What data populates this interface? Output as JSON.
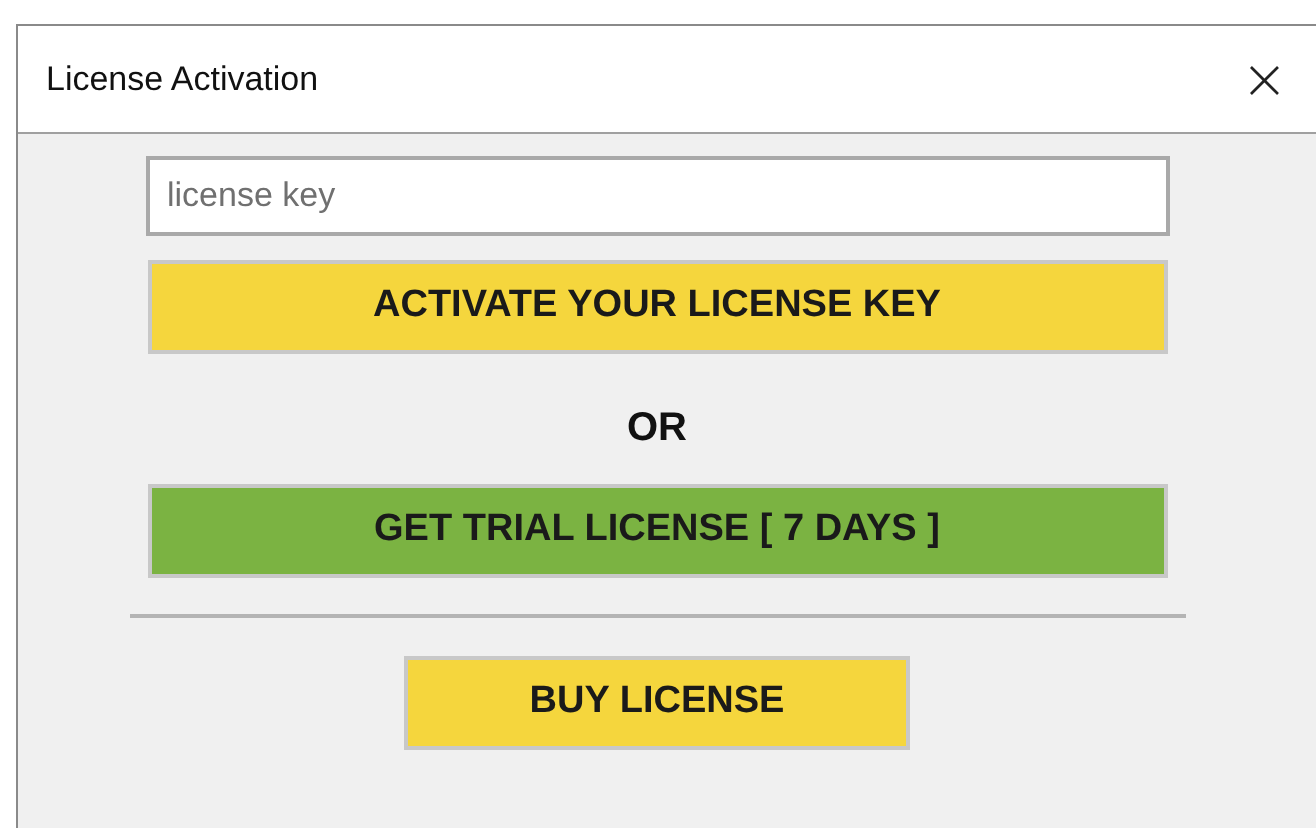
{
  "window": {
    "title": "License Activation",
    "close": "×"
  },
  "license_field": {
    "placeholder": "license key"
  },
  "buttons": [
    {
      "label": "ACTIVATE YOUR LICENSE KEY",
      "color": "#f5d63d"
    }
  ],
  "separator_text": "OR",
  "trial_buttons": [
    {
      "label": "GET TRIAL LICENSE [ 7 DAYS ]",
      "color": "#7bb342"
    }
  ],
  "footer_buttons": [
    {
      "label": "BUY LICENSE",
      "color": "#f5d63d"
    }
  ]
}
